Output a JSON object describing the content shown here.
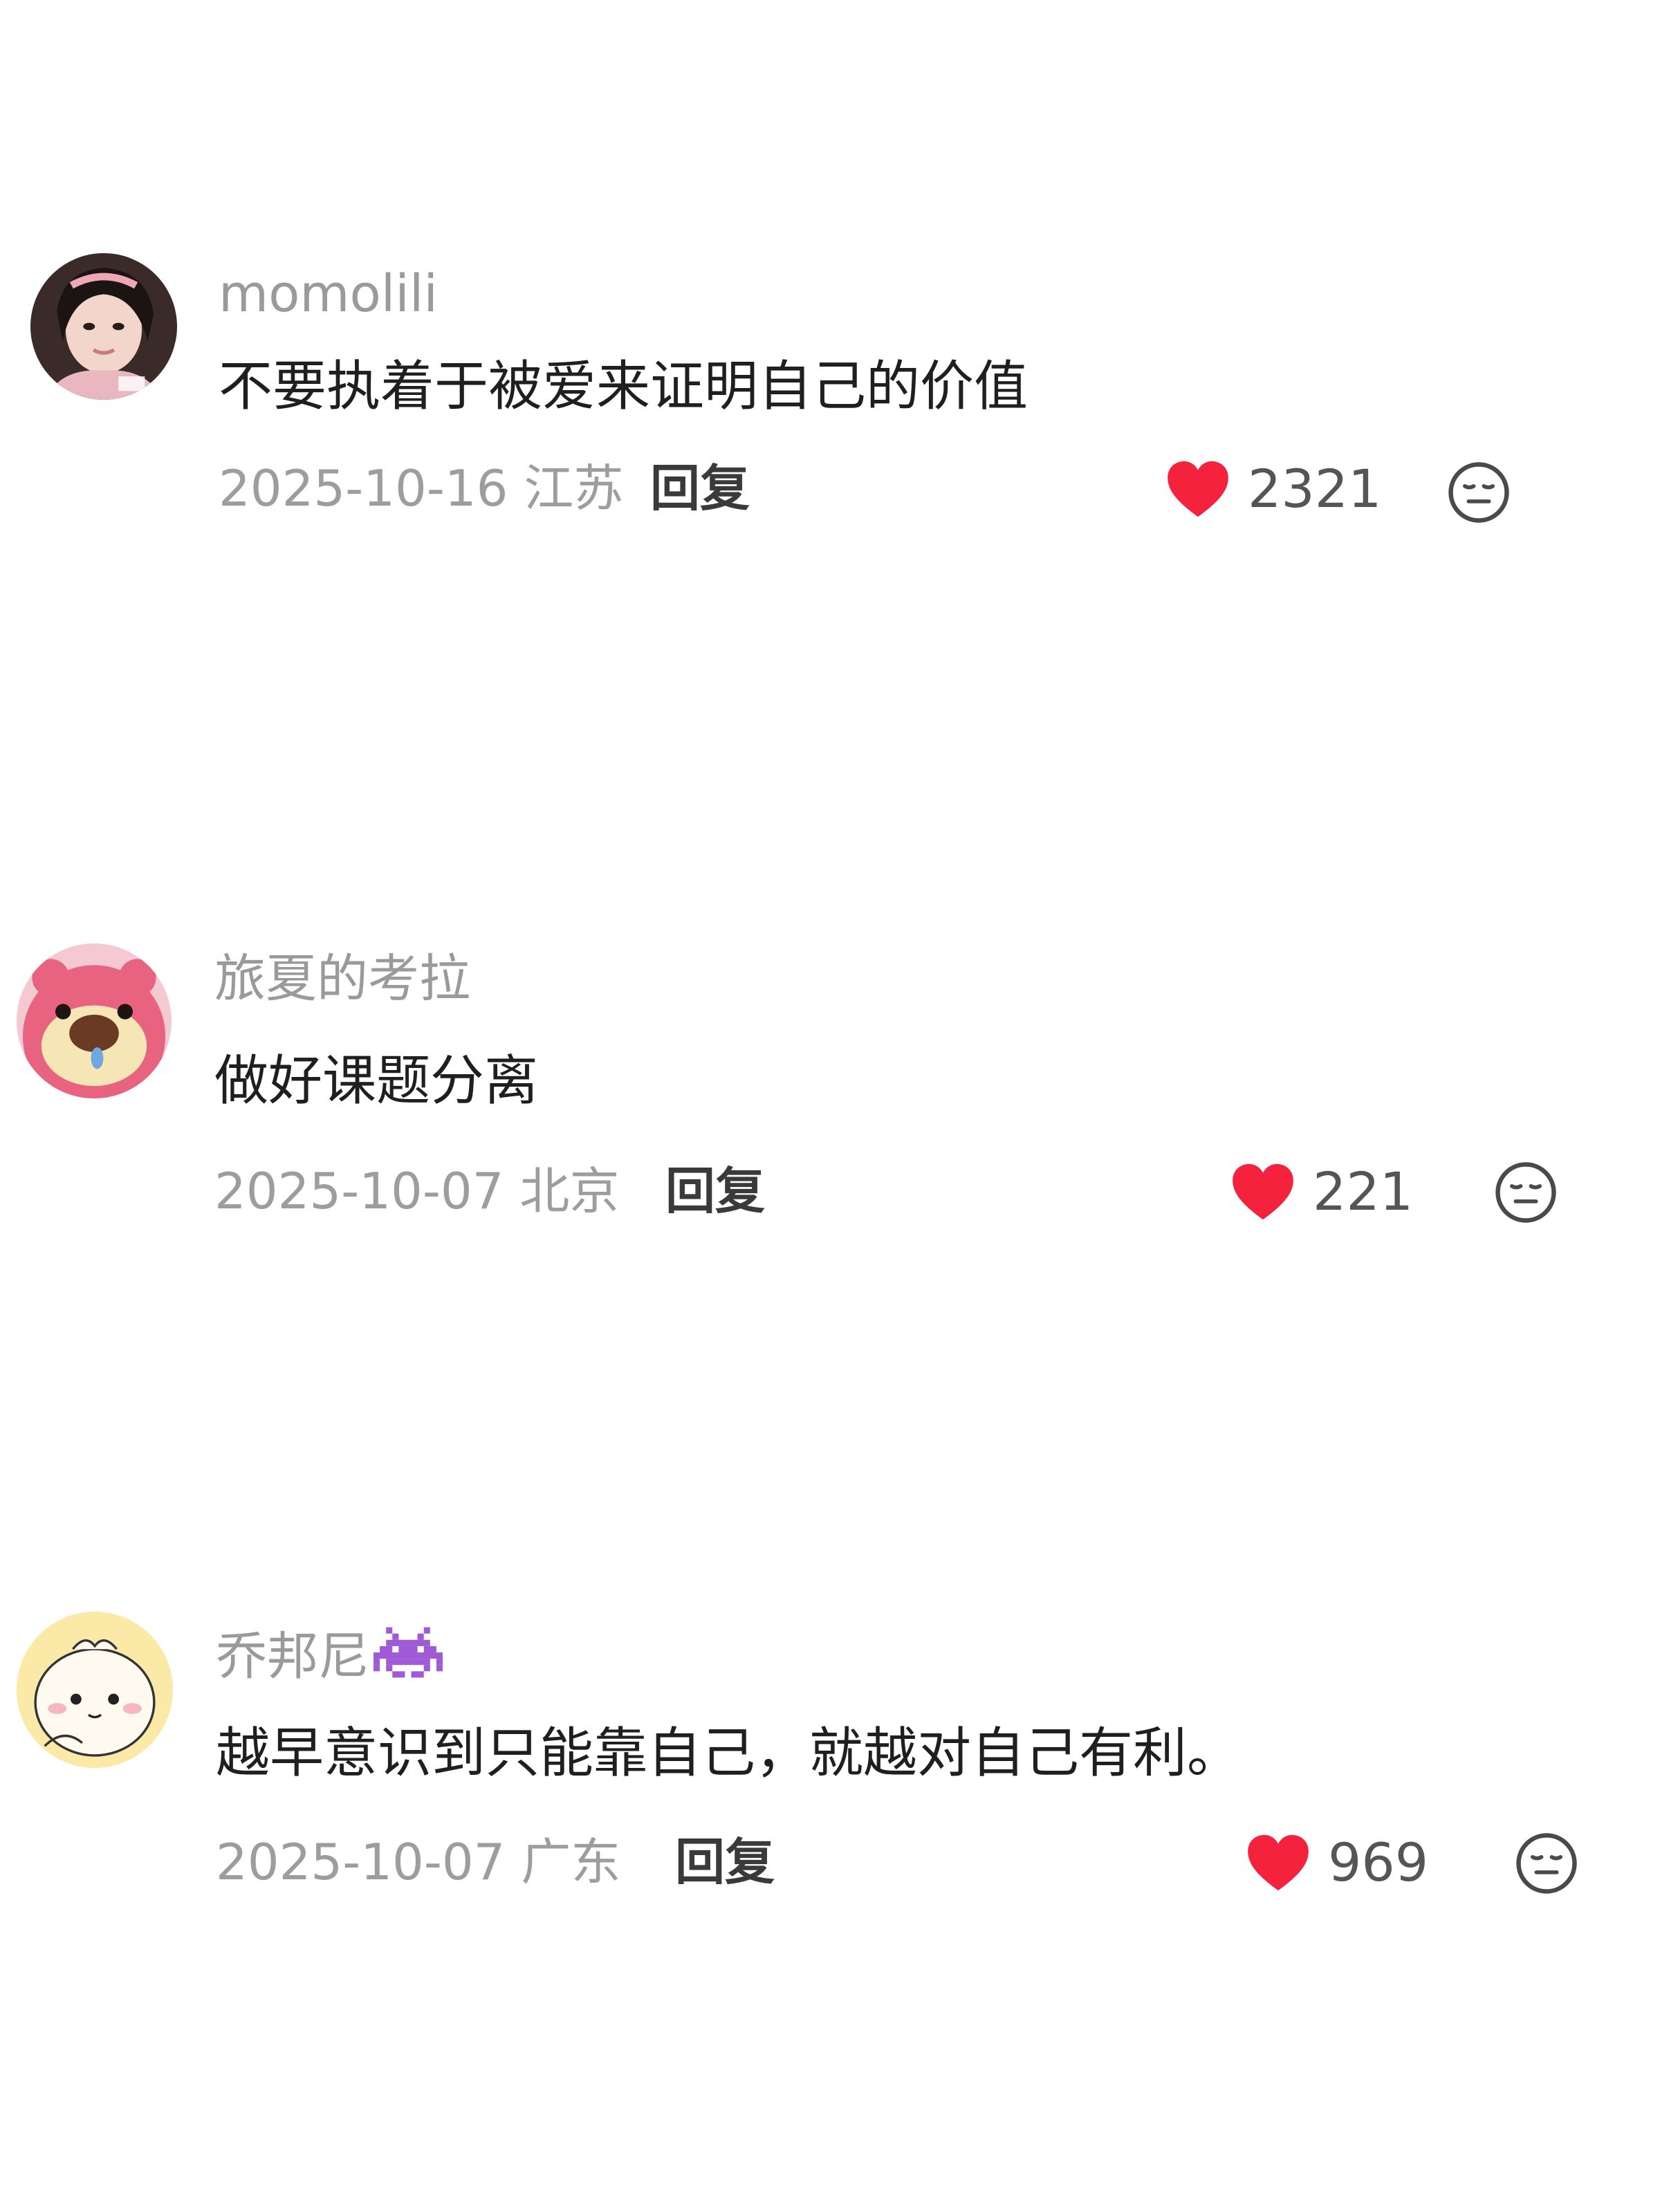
{
  "colors": {
    "username": "#9a9a9a",
    "comment_text": "#1f1f1f",
    "meta": "#9d9d9d",
    "reply": "#3a3a3a",
    "heart": "#f5223d",
    "like_count": "#555555"
  },
  "comments": [
    {
      "username": "momolili",
      "avatar_icon": "user-avatar-photo",
      "text": "不要执着于被爱来证明自己的价值",
      "date_location": "2025-10-16 江苏",
      "reply_label": "回复",
      "like_icon": "heart-icon",
      "likes": "2321",
      "reaction_icon": "expressionless-face-icon"
    },
    {
      "username": "旅夏的考拉",
      "avatar_icon": "strawberry-bear-avatar",
      "text": "做好课题分离",
      "date_location": "2025-10-07 北京",
      "reply_label": "回复",
      "like_icon": "heart-icon",
      "likes": "221",
      "reaction_icon": "expressionless-face-icon"
    },
    {
      "username": "乔邦尼",
      "username_badge_icon": "purple-space-invader-icon",
      "avatar_icon": "cartoon-chick-avatar",
      "text": "越早意识到只能靠自己，就越对自己有利。",
      "date_location": "2025-10-07 广东",
      "reply_label": "回复",
      "like_icon": "heart-icon",
      "likes": "969",
      "reaction_icon": "expressionless-face-icon"
    }
  ]
}
